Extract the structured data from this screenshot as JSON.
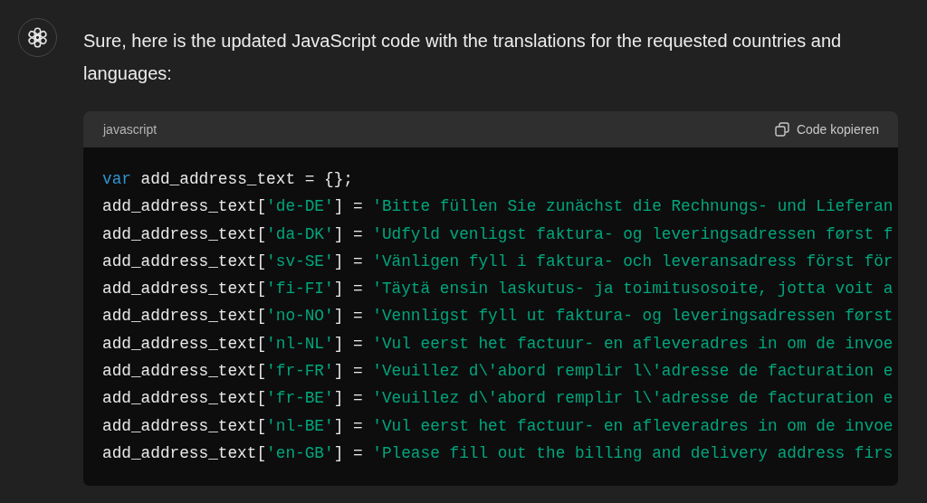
{
  "message": {
    "text": "Sure, here is the updated JavaScript code with the translations for the requested countries and languages:"
  },
  "code_block": {
    "language": "javascript",
    "copy_button": {
      "label": "Code kopieren"
    },
    "lines": [
      {
        "tokens": [
          {
            "kind": "keyword",
            "text": "var"
          },
          {
            "kind": "plain",
            "text": " add_address_text = {};"
          }
        ]
      },
      {
        "tokens": [
          {
            "kind": "plain",
            "text": "add_address_text["
          },
          {
            "kind": "string",
            "text": "'de-DE'"
          },
          {
            "kind": "plain",
            "text": "] = "
          },
          {
            "kind": "string",
            "text": "'Bitte füllen Sie zunächst die Rechnungs- und Lieferan"
          }
        ]
      },
      {
        "tokens": [
          {
            "kind": "plain",
            "text": "add_address_text["
          },
          {
            "kind": "string",
            "text": "'da-DK'"
          },
          {
            "kind": "plain",
            "text": "] = "
          },
          {
            "kind": "string",
            "text": "'Udfyld venligst faktura- og leveringsadressen først f"
          }
        ]
      },
      {
        "tokens": [
          {
            "kind": "plain",
            "text": "add_address_text["
          },
          {
            "kind": "string",
            "text": "'sv-SE'"
          },
          {
            "kind": "plain",
            "text": "] = "
          },
          {
            "kind": "string",
            "text": "'Vänligen fyll i faktura- och leveransadress först för"
          }
        ]
      },
      {
        "tokens": [
          {
            "kind": "plain",
            "text": "add_address_text["
          },
          {
            "kind": "string",
            "text": "'fi-FI'"
          },
          {
            "kind": "plain",
            "text": "] = "
          },
          {
            "kind": "string",
            "text": "'Täytä ensin laskutus- ja toimitusosoite, jotta voit a"
          }
        ]
      },
      {
        "tokens": [
          {
            "kind": "plain",
            "text": "add_address_text["
          },
          {
            "kind": "string",
            "text": "'no-NO'"
          },
          {
            "kind": "plain",
            "text": "] = "
          },
          {
            "kind": "string",
            "text": "'Vennligst fyll ut faktura- og leveringsadressen først"
          }
        ]
      },
      {
        "tokens": [
          {
            "kind": "plain",
            "text": "add_address_text["
          },
          {
            "kind": "string",
            "text": "'nl-NL'"
          },
          {
            "kind": "plain",
            "text": "] = "
          },
          {
            "kind": "string",
            "text": "'Vul eerst het factuur- en afleveradres in om de invoe"
          }
        ]
      },
      {
        "tokens": [
          {
            "kind": "plain",
            "text": "add_address_text["
          },
          {
            "kind": "string",
            "text": "'fr-FR'"
          },
          {
            "kind": "plain",
            "text": "] = "
          },
          {
            "kind": "string",
            "text": "'Veuillez d\\'abord remplir l\\'adresse de facturation e"
          }
        ]
      },
      {
        "tokens": [
          {
            "kind": "plain",
            "text": "add_address_text["
          },
          {
            "kind": "string",
            "text": "'fr-BE'"
          },
          {
            "kind": "plain",
            "text": "] = "
          },
          {
            "kind": "string",
            "text": "'Veuillez d\\'abord remplir l\\'adresse de facturation e"
          }
        ]
      },
      {
        "tokens": [
          {
            "kind": "plain",
            "text": "add_address_text["
          },
          {
            "kind": "string",
            "text": "'nl-BE'"
          },
          {
            "kind": "plain",
            "text": "] = "
          },
          {
            "kind": "string",
            "text": "'Vul eerst het factuur- en afleveradres in om de invoe"
          }
        ]
      },
      {
        "tokens": [
          {
            "kind": "plain",
            "text": "add_address_text["
          },
          {
            "kind": "string",
            "text": "'en-GB'"
          },
          {
            "kind": "plain",
            "text": "] = "
          },
          {
            "kind": "string",
            "text": "'Please fill out the billing and delivery address firs"
          }
        ]
      }
    ]
  }
}
